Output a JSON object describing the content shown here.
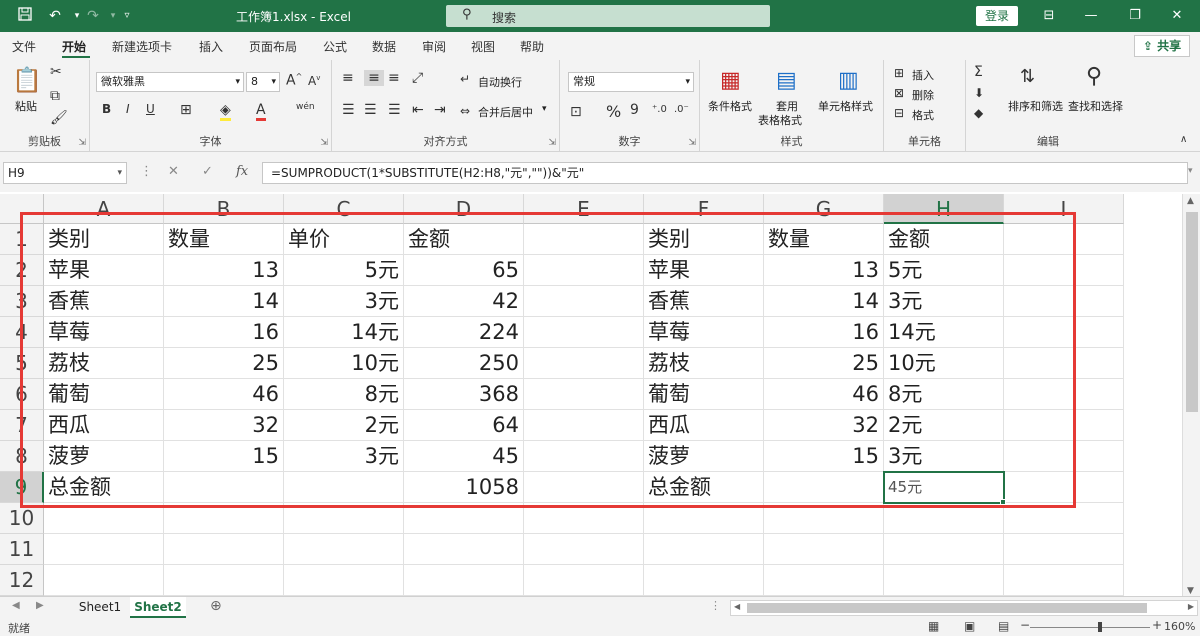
{
  "titlebar": {
    "doc_title": "工作簿1.xlsx  -  Excel",
    "search_placeholder": "搜索",
    "login": "登录",
    "icons": [
      "save-icon",
      "undo-icon",
      "redo-icon",
      "customize-icon"
    ]
  },
  "menu": {
    "items": [
      "文件",
      "开始",
      "新建选项卡",
      "插入",
      "页面布局",
      "公式",
      "数据",
      "审阅",
      "视图",
      "帮助"
    ],
    "active": "开始",
    "share": "共享"
  },
  "ribbon": {
    "clipboard": {
      "paste": "粘贴",
      "label": "剪贴板"
    },
    "font": {
      "name": "微软雅黑",
      "size": "8",
      "bold": "B",
      "italic": "I",
      "underline": "U",
      "label": "字体",
      "wen": "wén"
    },
    "alignment": {
      "wrap": "自动换行",
      "merge": "合并后居中",
      "label": "对齐方式"
    },
    "number": {
      "format": "常规",
      "percent": "%",
      "comma": "9",
      "label": "数字"
    },
    "styles": {
      "conditional": "条件格式",
      "table1": "套用",
      "table2": "表格格式",
      "cell": "单元格样式",
      "label": "样式"
    },
    "cells": {
      "insert": "插入",
      "delete": "删除",
      "format": "格式",
      "label": "单元格"
    },
    "editing": {
      "sort": "排序和筛选",
      "find": "查找和选择",
      "label": "编辑"
    }
  },
  "formula_bar": {
    "namebox": "H9",
    "formula": "=SUMPRODUCT(1*SUBSTITUTE(H2:H8,\"元\",\"\"))&\"元\""
  },
  "grid": {
    "columns": [
      "A",
      "B",
      "C",
      "D",
      "E",
      "F",
      "G",
      "H",
      "I"
    ],
    "selected_column": "H",
    "rows": [
      "1",
      "2",
      "3",
      "4",
      "5",
      "6",
      "7",
      "8",
      "9",
      "10",
      "11",
      "12"
    ],
    "selected_row": "9",
    "cells": [
      [
        "类别",
        "数量",
        "单价",
        "金额",
        "",
        "类别",
        "数量",
        "金额",
        ""
      ],
      [
        "苹果",
        "13",
        "5元",
        "65",
        "",
        "苹果",
        "13",
        "5元",
        ""
      ],
      [
        "香蕉",
        "14",
        "3元",
        "42",
        "",
        "香蕉",
        "14",
        "3元",
        ""
      ],
      [
        "草莓",
        "16",
        "14元",
        "224",
        "",
        "草莓",
        "16",
        "14元",
        ""
      ],
      [
        "荔枝",
        "25",
        "10元",
        "250",
        "",
        "荔枝",
        "25",
        "10元",
        ""
      ],
      [
        "葡萄",
        "46",
        "8元",
        "368",
        "",
        "葡萄",
        "46",
        "8元",
        ""
      ],
      [
        "西瓜",
        "32",
        "2元",
        "64",
        "",
        "西瓜",
        "32",
        "2元",
        ""
      ],
      [
        "菠萝",
        "15",
        "3元",
        "45",
        "",
        "菠萝",
        "15",
        "3元",
        ""
      ],
      [
        "总金额",
        "",
        "",
        "1058",
        "",
        "总金额",
        "",
        "45元",
        ""
      ],
      [
        "",
        "",
        "",
        "",
        "",
        "",
        "",
        "",
        ""
      ],
      [
        "",
        "",
        "",
        "",
        "",
        "",
        "",
        "",
        ""
      ],
      [
        "",
        "",
        "",
        "",
        "",
        "",
        "",
        "",
        ""
      ]
    ]
  },
  "sheets": {
    "tabs": [
      "Sheet1",
      "Sheet2"
    ],
    "active": "Sheet2",
    "add": "⊕"
  },
  "status": {
    "ready": "就绪",
    "zoom": "160%"
  },
  "colors": {
    "excel_green": "#217346",
    "highlight_red": "#e53935"
  }
}
